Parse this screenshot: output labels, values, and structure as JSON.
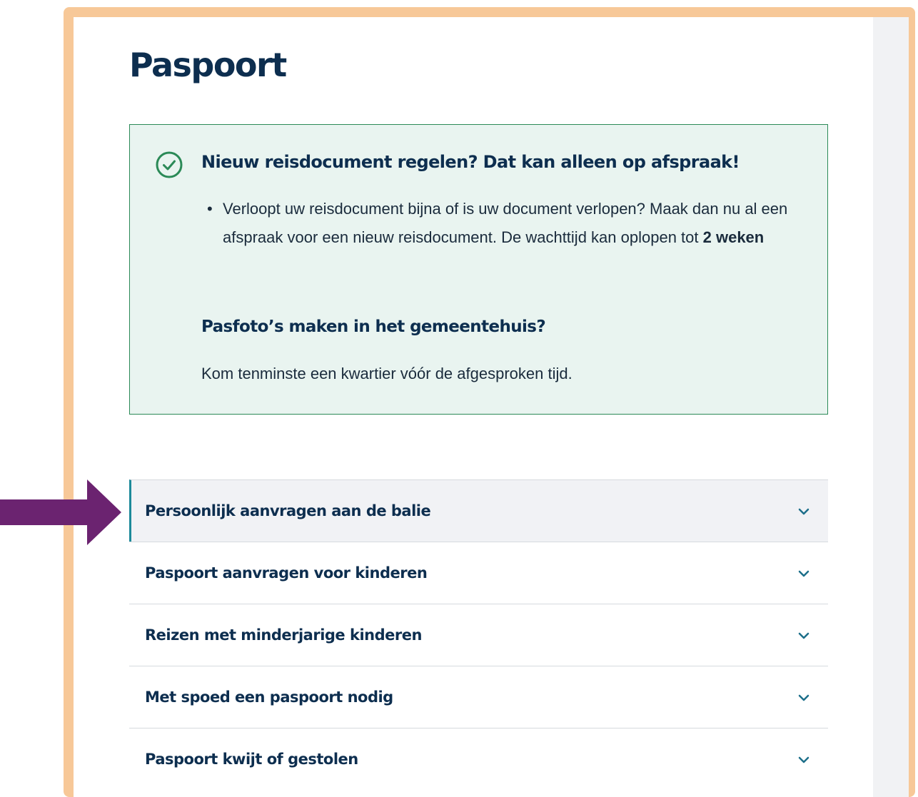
{
  "page": {
    "title": "Paspoort"
  },
  "notice": {
    "icon": "check-circle-icon",
    "title": "Nieuw reisdocument regelen? Dat kan alleen op afspraak!",
    "bullet_text": "Verloopt uw reisdocument bijna of is uw document verlopen? Maak dan nu al een afspraak voor een nieuw reisdocument. De wachttijd kan oplopen tot ",
    "bullet_emphasis": "2 weken",
    "subtitle": "Pasfoto’s maken in het gemeentehuis?",
    "text": "Kom tenminste een kwartier vóór de afgesproken tijd."
  },
  "accordion": {
    "items": [
      {
        "label": "Persoonlijk aanvragen aan de balie",
        "active": true
      },
      {
        "label": "Paspoort aanvragen voor kinderen",
        "active": false
      },
      {
        "label": "Reizen met minderjarige kinderen",
        "active": false
      },
      {
        "label": "Met spoed een paspoort nodig",
        "active": false
      },
      {
        "label": "Paspoort kwijt of gestolen",
        "active": false
      }
    ],
    "chevron_icon": "chevron-down-icon"
  },
  "colors": {
    "frame": "#f7c898",
    "title": "#0d2e4f",
    "notice_bg": "#e9f4f0",
    "notice_border": "#2b8a57",
    "accordion_accent": "#1d8a9a",
    "arrow": "#6b2370"
  }
}
